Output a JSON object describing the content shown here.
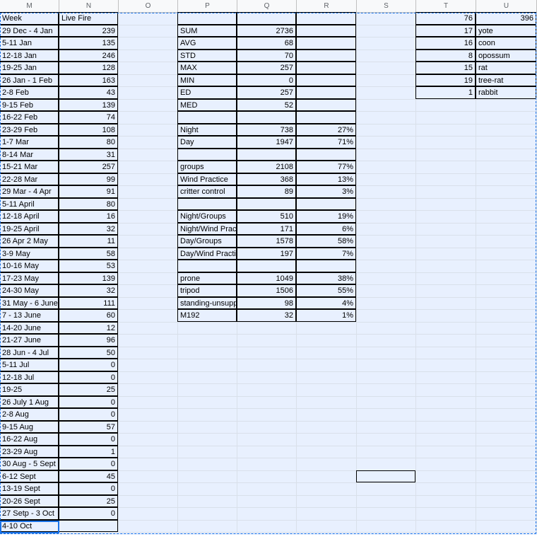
{
  "columns": [
    "M",
    "N",
    "O",
    "P",
    "Q",
    "R",
    "S",
    "T",
    "U"
  ],
  "weeks": [
    [
      "Week",
      "Live Fire"
    ],
    [
      "29 Dec - 4 Jan",
      "239"
    ],
    [
      "5-11 Jan",
      "135"
    ],
    [
      "12-18 Jan",
      "246"
    ],
    [
      "19-25 Jan",
      "128"
    ],
    [
      "26 Jan - 1 Feb",
      "163"
    ],
    [
      "2-8 Feb",
      "43"
    ],
    [
      " 9-15 Feb",
      "139"
    ],
    [
      " 16-22 Feb",
      "74"
    ],
    [
      " 23-29 Feb",
      "108"
    ],
    [
      "1-7 Mar",
      "80"
    ],
    [
      "8-14 Mar",
      "31"
    ],
    [
      "15-21 Mar",
      "257"
    ],
    [
      "22-28 Mar",
      "99"
    ],
    [
      " 29 Mar - 4 Apr",
      "91"
    ],
    [
      "5-11 April",
      "80"
    ],
    [
      "12-18 April",
      "16"
    ],
    [
      "19-25 April",
      "32"
    ],
    [
      "26 Apr 2 May",
      "11"
    ],
    [
      "3-9 May",
      "58"
    ],
    [
      "10-16 May",
      "53"
    ],
    [
      "17-23 May",
      "139"
    ],
    [
      "24-30 May",
      "32"
    ],
    [
      "31 May - 6 June",
      "111"
    ],
    [
      "7 - 13 June",
      "60"
    ],
    [
      "14-20 June",
      "12"
    ],
    [
      "21-27 June",
      "96"
    ],
    [
      "28 Jun - 4 Jul",
      "50"
    ],
    [
      "5-11 Jul",
      "0"
    ],
    [
      "12-18 Jul",
      "0"
    ],
    [
      "19-25",
      "25"
    ],
    [
      "26 July 1 Aug",
      "0"
    ],
    [
      "2-8 Aug",
      "0"
    ],
    [
      "9-15 Aug",
      "57"
    ],
    [
      "16-22 Aug",
      "0"
    ],
    [
      "23-29 Aug",
      "1"
    ],
    [
      "30 Aug - 5 Sept",
      "0"
    ],
    [
      "6-12 Sept",
      "45"
    ],
    [
      "13-19 Sept",
      "0"
    ],
    [
      "20-26 Sept",
      "25"
    ],
    [
      "27 Setp - 3 Oct",
      "0"
    ],
    [
      "4-10 Oct",
      ""
    ]
  ],
  "stats": [
    {
      "row": 1,
      "label": "SUM",
      "value": "2736",
      "pct": ""
    },
    {
      "row": 2,
      "label": "AVG",
      "value": "68",
      "pct": ""
    },
    {
      "row": 3,
      "label": "STD",
      "value": "70",
      "pct": ""
    },
    {
      "row": 4,
      "label": "MAX",
      "value": "257",
      "pct": ""
    },
    {
      "row": 5,
      "label": "MIN",
      "value": "0",
      "pct": ""
    },
    {
      "row": 6,
      "label": "ED",
      "value": "257",
      "pct": ""
    },
    {
      "row": 7,
      "label": "MED",
      "value": "52",
      "pct": ""
    },
    {
      "row": 8,
      "label": "",
      "value": "",
      "pct": ""
    },
    {
      "row": 9,
      "label": "Night",
      "value": "738",
      "pct": "27%"
    },
    {
      "row": 10,
      "label": "Day",
      "value": "1947",
      "pct": "71%"
    },
    {
      "row": 11,
      "label": "",
      "value": "",
      "pct": ""
    },
    {
      "row": 12,
      "label": "groups",
      "value": "2108",
      "pct": "77%"
    },
    {
      "row": 13,
      "label": "Wind Practice",
      "value": "368",
      "pct": "13%"
    },
    {
      "row": 14,
      "label": "critter control",
      "value": "89",
      "pct": "3%"
    },
    {
      "row": 15,
      "label": "",
      "value": "",
      "pct": ""
    },
    {
      "row": 16,
      "label": "Night/Groups",
      "value": "510",
      "pct": "19%"
    },
    {
      "row": 17,
      "label": "Night/Wind Prac",
      "value": "171",
      "pct": "6%"
    },
    {
      "row": 18,
      "label": "Day/Groups",
      "value": "1578",
      "pct": "58%"
    },
    {
      "row": 19,
      "label": "Day/Wind Practi",
      "value": "197",
      "pct": "7%"
    },
    {
      "row": 20,
      "label": "",
      "value": "",
      "pct": ""
    },
    {
      "row": 21,
      "label": "prone",
      "value": "1049",
      "pct": "38%"
    },
    {
      "row": 22,
      "label": "tripod",
      "value": "1506",
      "pct": "55%"
    },
    {
      "row": 23,
      "label": "standing-unsupp",
      "value": "98",
      "pct": "4%"
    },
    {
      "row": 24,
      "label": "M192",
      "value": "32",
      "pct": "1%"
    }
  ],
  "critters": [
    {
      "count": "76",
      "name": "396"
    },
    {
      "count": "17",
      "name": "yote"
    },
    {
      "count": "16",
      "name": "coon"
    },
    {
      "count": "8",
      "name": "opossum"
    },
    {
      "count": "15",
      "name": "rat"
    },
    {
      "count": "19",
      "name": "tree-rat"
    },
    {
      "count": "1",
      "name": "rabbit"
    }
  ],
  "colors": {
    "selection": "#1a73e8",
    "grid_fill": "#e8f0fe"
  }
}
